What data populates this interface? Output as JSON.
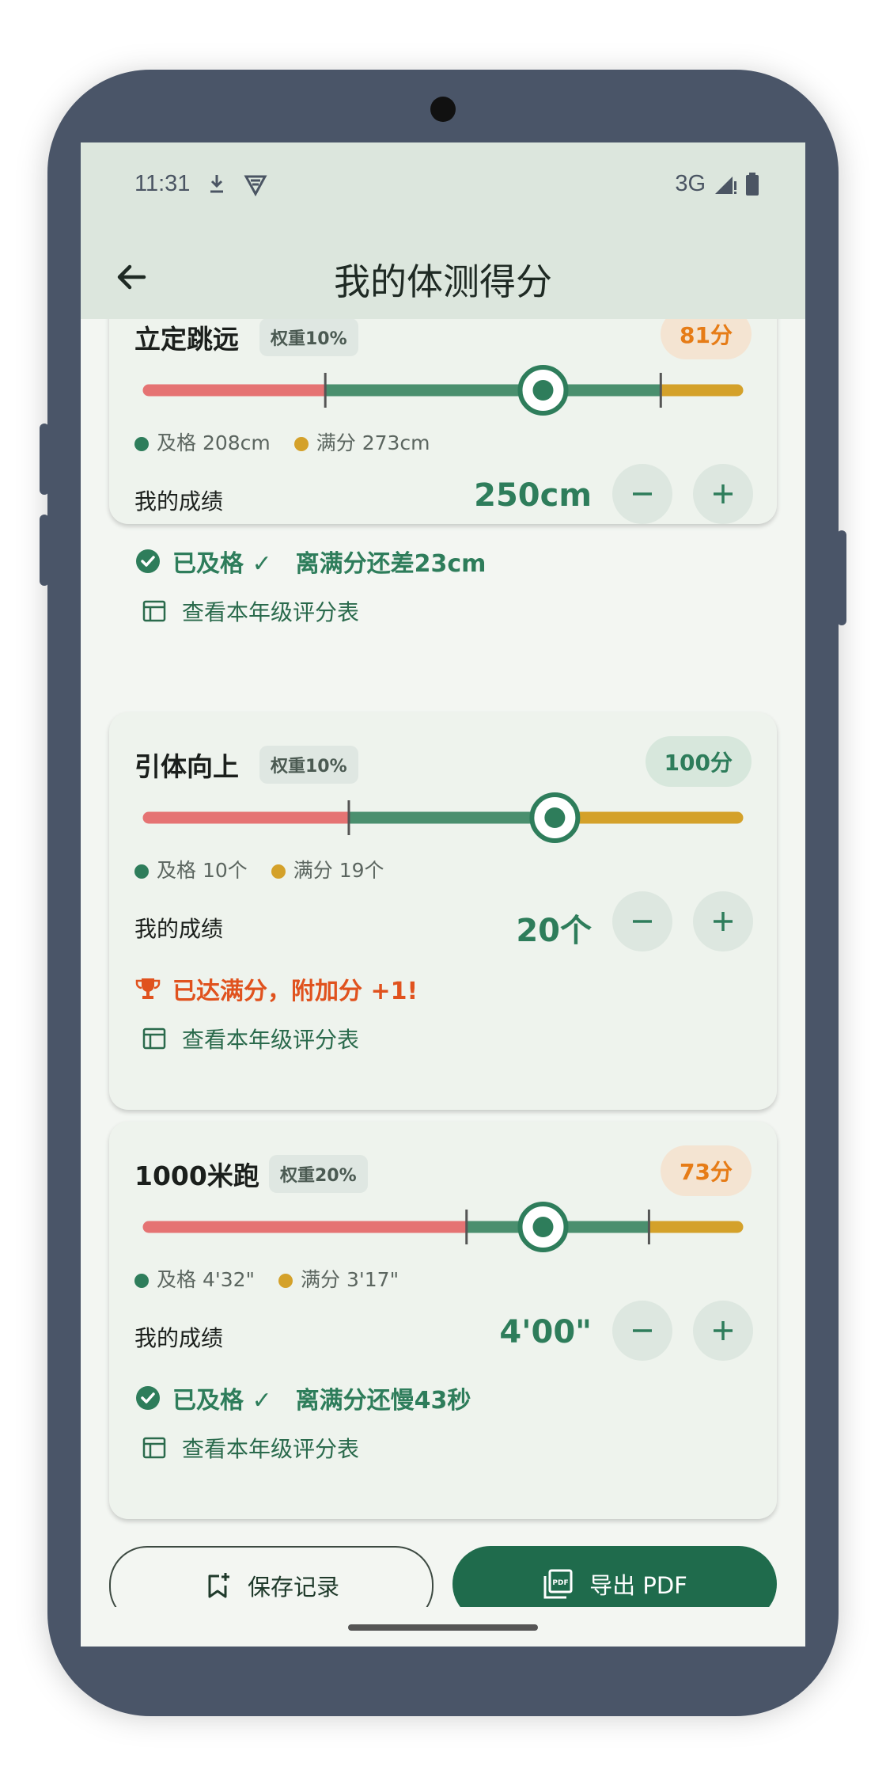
{
  "status_bar": {
    "time": "11:31",
    "network": "3G"
  },
  "app_bar": {
    "title": "我的体测得分"
  },
  "cards": [
    {
      "name": "立定跳远",
      "weight": "权重10%",
      "score": "81分",
      "score_level": "good",
      "pass_mark": 0.3,
      "full_mark": 0.87,
      "marker": 0.67,
      "legend_pass": "及格 208cm",
      "legend_full": "满分 273cm",
      "my_label": "我的成绩",
      "my_value": "250cm",
      "status_kind": "pass",
      "status_text": "已及格 ✓　离满分还差23cm",
      "link_text": "查看本年级评分表"
    },
    {
      "name": "引体向上",
      "weight": "权重10%",
      "score": "100分",
      "score_level": "full",
      "pass_mark": 0.34,
      "full_mark": 0.69,
      "marker": 0.69,
      "legend_pass": "及格 10个",
      "legend_full": "满分 19个",
      "my_label": "我的成绩",
      "my_value": "20个",
      "status_kind": "full",
      "status_text": "已达满分，附加分 +1!",
      "link_text": "查看本年级评分表"
    },
    {
      "name": "1000米跑",
      "weight": "权重20%",
      "score": "73分",
      "score_level": "good",
      "pass_mark": 0.54,
      "full_mark": 0.85,
      "marker": 0.67,
      "legend_pass": "及格 4'32\"",
      "legend_full": "满分 3'17\"",
      "my_label": "我的成绩",
      "my_value": "4'00\"",
      "status_kind": "pass",
      "status_text": "已及格 ✓　离满分还慢43秒",
      "link_text": "查看本年级评分表"
    }
  ],
  "actions": {
    "save": "保存记录",
    "export": "导出 PDF",
    "pdf_glyph": "PDF"
  },
  "colors": {
    "fail": "#e57373",
    "pass": "#4a8f6e",
    "full": "#d4a12a",
    "accent": "#2e7d5b",
    "alert": "#e0521e",
    "score_good_bg": "#f4e4d2",
    "score_good_fg": "#e67c17",
    "score_full_bg": "#d7e7dc",
    "score_full_fg": "#2e7d5b"
  }
}
